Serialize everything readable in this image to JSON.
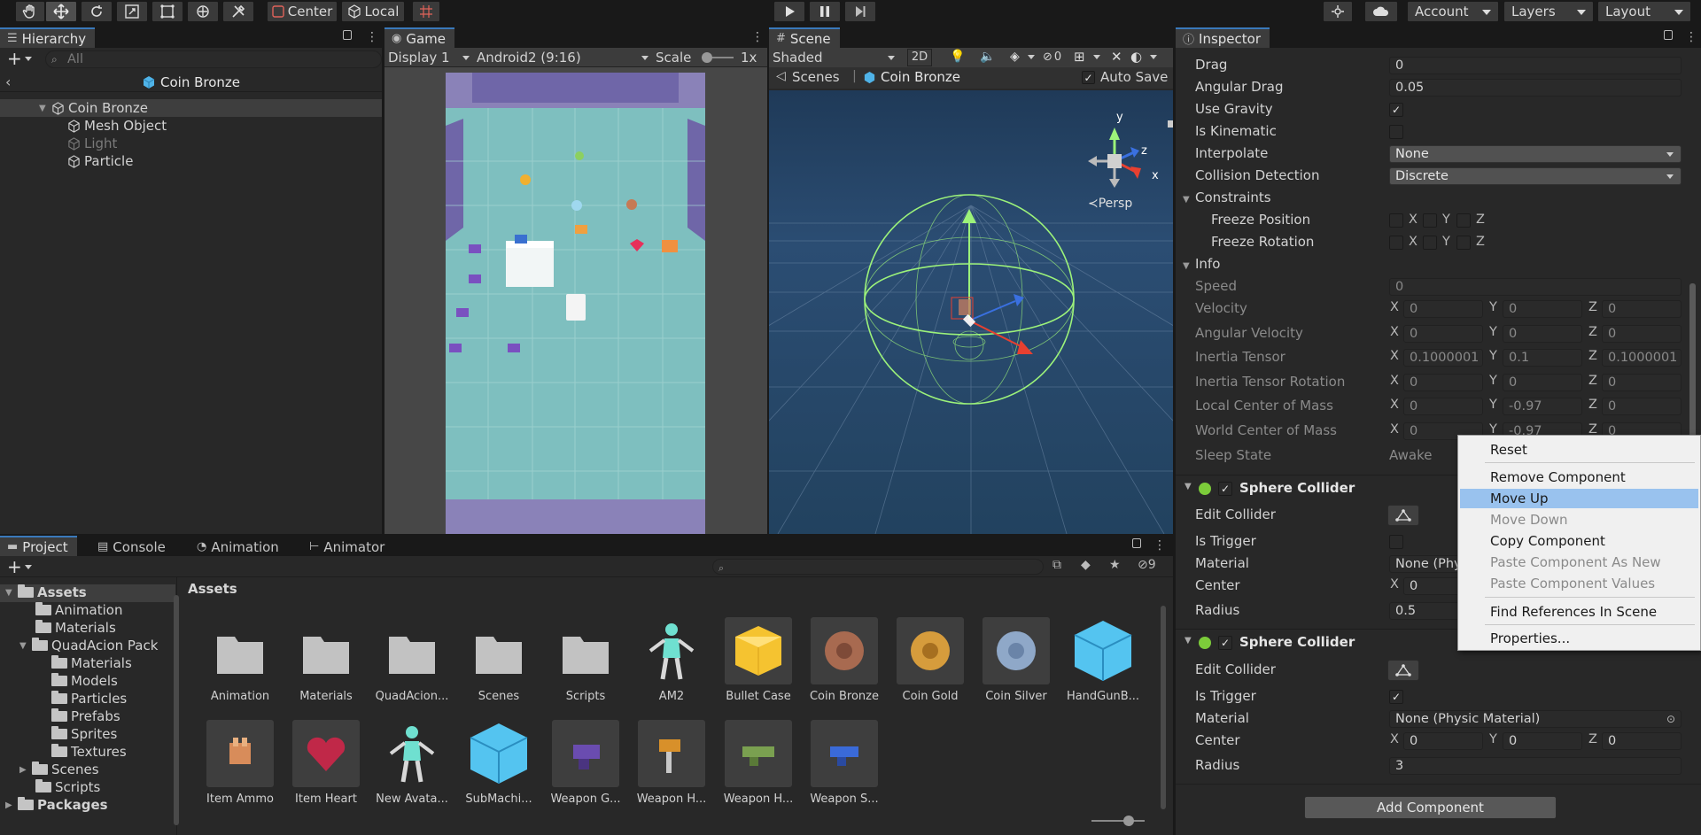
{
  "toolbar": {
    "pivot": "Center",
    "space": "Local",
    "account": "Account",
    "layers": "Layers",
    "layout": "Layout"
  },
  "hierarchy": {
    "tab": "Hierarchy",
    "search_placeholder": "All",
    "scene_title": "Coin Bronze",
    "items": [
      "Coin Bronze",
      "Mesh Object",
      "Light",
      "Particle"
    ]
  },
  "game": {
    "tab": "Game",
    "display": "Display 1",
    "aspect": "Android2 (9:16)",
    "scale_label": "Scale",
    "scale_value": "1x"
  },
  "scene": {
    "tab": "Scene",
    "shading": "Shaded",
    "mode_2d": "2D",
    "hidden_count": "0",
    "breadcrumb_root": "Scenes",
    "breadcrumb_prefab": "Coin Bronze",
    "auto_save": "Auto Save",
    "projection": "Persp",
    "gizmo_axes": [
      "y",
      "z",
      "x"
    ]
  },
  "project": {
    "tabs": [
      "Project",
      "Console",
      "Animation",
      "Animator"
    ],
    "hidden_count": "9",
    "breadcrumb": "Assets",
    "tree": [
      "Assets",
      "Animation",
      "Materials",
      "QuadAcion Pack",
      "Materials",
      "Models",
      "Particles",
      "Prefabs",
      "Sprites",
      "Textures",
      "Scenes",
      "Scripts",
      "Packages"
    ],
    "assets": [
      {
        "name": "Animation",
        "kind": "folder-icon"
      },
      {
        "name": "Materials",
        "kind": "folder-icon"
      },
      {
        "name": "QuadAcion...",
        "kind": "folder-icon"
      },
      {
        "name": "Scenes",
        "kind": "folder-icon"
      },
      {
        "name": "Scripts",
        "kind": "folder-icon"
      },
      {
        "name": "AM2",
        "kind": "avatar-icon"
      },
      {
        "name": "Bullet Case",
        "kind": "yellow-cube-icon"
      },
      {
        "name": "Coin Bronze",
        "kind": "bronze-coin-icon"
      },
      {
        "name": "Coin Gold",
        "kind": "gold-coin-icon"
      },
      {
        "name": "Coin Silver",
        "kind": "silver-coin-icon"
      },
      {
        "name": "HandGunB...",
        "kind": "prefab-cube-icon"
      },
      {
        "name": "Item Ammo",
        "kind": "ammo-box-icon"
      },
      {
        "name": "Item Heart",
        "kind": "heart-icon"
      },
      {
        "name": "New Avata...",
        "kind": "avatar-icon"
      },
      {
        "name": "SubMachi...",
        "kind": "prefab-cube-icon"
      },
      {
        "name": "Weapon G...",
        "kind": "weapon-icon"
      },
      {
        "name": "Weapon H...",
        "kind": "hammer-icon"
      },
      {
        "name": "Weapon H...",
        "kind": "weapon-icon"
      },
      {
        "name": "Weapon S...",
        "kind": "weapon-icon"
      }
    ]
  },
  "inspector": {
    "tab": "Inspector",
    "rigidbody": {
      "drag_label": "Drag",
      "drag": "0",
      "angular_drag_label": "Angular Drag",
      "angular_drag": "0.05",
      "use_gravity_label": "Use Gravity",
      "use_gravity": true,
      "is_kinematic_label": "Is Kinematic",
      "is_kinematic": false,
      "interpolate_label": "Interpolate",
      "interpolate": "None",
      "collision_label": "Collision Detection",
      "collision": "Discrete",
      "constraints_label": "Constraints",
      "freeze_pos_label": "Freeze Position",
      "freeze_rot_label": "Freeze Rotation",
      "info_label": "Info",
      "speed_label": "Speed",
      "speed": "0",
      "velocity_label": "Velocity",
      "velocity": [
        "0",
        "0",
        "0"
      ],
      "ang_velocity_label": "Angular Velocity",
      "ang_velocity": [
        "0",
        "0",
        "0"
      ],
      "inertia_label": "Inertia Tensor",
      "inertia": [
        "0.1000001",
        "0.1",
        "0.1000001"
      ],
      "inertia_rot_label": "Inertia Tensor Rotation",
      "inertia_rot": [
        "0",
        "0",
        "0"
      ],
      "local_com_label": "Local Center of Mass",
      "local_com": [
        "0",
        "-0.97",
        "0"
      ],
      "world_com_label": "World Center of Mass",
      "world_com": [
        "0",
        "-0.97",
        "0"
      ],
      "sleep_label": "Sleep State",
      "sleep": "Awake"
    },
    "collider1": {
      "title": "Sphere Collider",
      "edit_label": "Edit Collider",
      "trigger_label": "Is Trigger",
      "trigger": false,
      "material_label": "Material",
      "material": "None (Phys",
      "center_label": "Center",
      "center_x": "0",
      "radius_label": "Radius",
      "radius": "0.5"
    },
    "collider2": {
      "title": "Sphere Collider",
      "edit_label": "Edit Collider",
      "trigger_label": "Is Trigger",
      "trigger": true,
      "material_label": "Material",
      "material": "None (Physic Material)",
      "center_label": "Center",
      "center": [
        "0",
        "0",
        "0"
      ],
      "radius_label": "Radius",
      "radius": "3"
    },
    "add_component": "Add Component"
  },
  "context_menu": {
    "items": [
      "Reset",
      "Remove Component",
      "Move Up",
      "Move Down",
      "Copy Component",
      "Paste Component As New",
      "Paste Component Values",
      "Find References In Scene",
      "Properties..."
    ],
    "highlighted": "Move Up",
    "disabled": [
      "Move Down",
      "Paste Component As New",
      "Paste Component Values"
    ]
  },
  "colors": {
    "accent": "#3a79bb",
    "menu_highlight": "#99c2ee",
    "collider_gizmo": "#9cf27a",
    "scene_bg": "#2b4a6e",
    "game_floor": "#7cc0c0"
  }
}
